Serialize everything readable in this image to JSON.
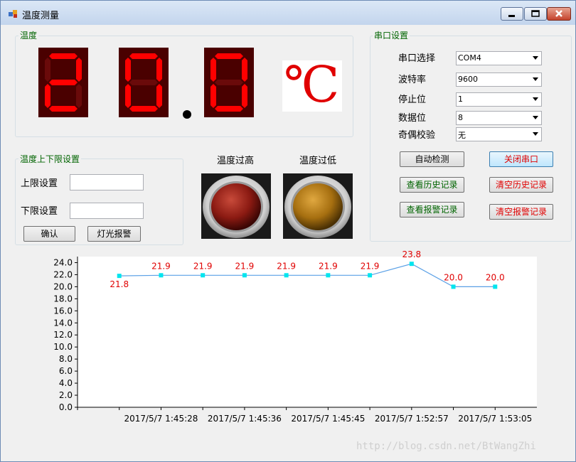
{
  "window": {
    "title": "温度测量"
  },
  "temperature": {
    "group_title": "温度",
    "digits": [
      "2",
      "0",
      "0"
    ],
    "decimal_point": ".",
    "unit": "℃",
    "digit_color": "#ff0000",
    "digit_bg": "#4a0000"
  },
  "limits": {
    "group_title": "温度上下限设置",
    "upper_label": "上限设置",
    "upper_value": "",
    "lower_label": "下限设置",
    "lower_value": "",
    "confirm_label": "确认",
    "light_alarm_label": "灯光报警"
  },
  "lamps": {
    "high_label": "温度过高",
    "low_label": "温度过低",
    "high_color": "#8b1a12",
    "low_color": "#a66f10"
  },
  "serial": {
    "group_title": "串口设置",
    "fields": [
      {
        "label": "串口选择",
        "value": "COM4"
      },
      {
        "label": "波特率",
        "value": "9600"
      },
      {
        "label": "停止位",
        "value": "1"
      },
      {
        "label": "数据位",
        "value": "8"
      },
      {
        "label": "奇偶校验",
        "value": "无"
      }
    ],
    "buttons": {
      "auto_detect": "自动检测",
      "close_port": "关闭串口",
      "view_history": "查看历史记录",
      "clear_history": "清空历史记录",
      "view_alarm": "查看报警记录",
      "clear_alarm": "清空报警记录"
    }
  },
  "chart_data": {
    "type": "line",
    "x": [
      "",
      "",
      "2017/5/7 1:45:28",
      "",
      "2017/5/7 1:45:36",
      "",
      "2017/5/7 1:45:45",
      "",
      "2017/5/7 1:52:57",
      "",
      "2017/5/7 1:53:05"
    ],
    "series": [
      {
        "values": [
          21.8,
          21.9,
          21.9,
          21.9,
          21.9,
          21.9,
          21.9,
          23.8,
          20.0,
          20.0
        ]
      }
    ],
    "data_labels": [
      "21.8",
      "21.9",
      "21.9",
      "21.9",
      "21.9",
      "21.9",
      "21.9",
      "23.8",
      "20.0",
      "20.0"
    ],
    "x_tick_labels": [
      "2017/5/7 1:45:28",
      "2017/5/7 1:45:36",
      "2017/5/7 1:45:45",
      "2017/5/7 1:52:57",
      "2017/5/7 1:53:05"
    ],
    "y_ticks": [
      "0.0",
      "2.0",
      "4.0",
      "6.0",
      "8.0",
      "10.0",
      "12.0",
      "14.0",
      "16.0",
      "18.0",
      "20.0",
      "22.0",
      "24.0"
    ],
    "ylim": [
      0,
      25
    ],
    "line_color": "#5aa0e6",
    "marker_color": "#00e5ee",
    "label_color": "#e00000"
  },
  "watermark": "http://blog.csdn.net/BtWangZhi"
}
